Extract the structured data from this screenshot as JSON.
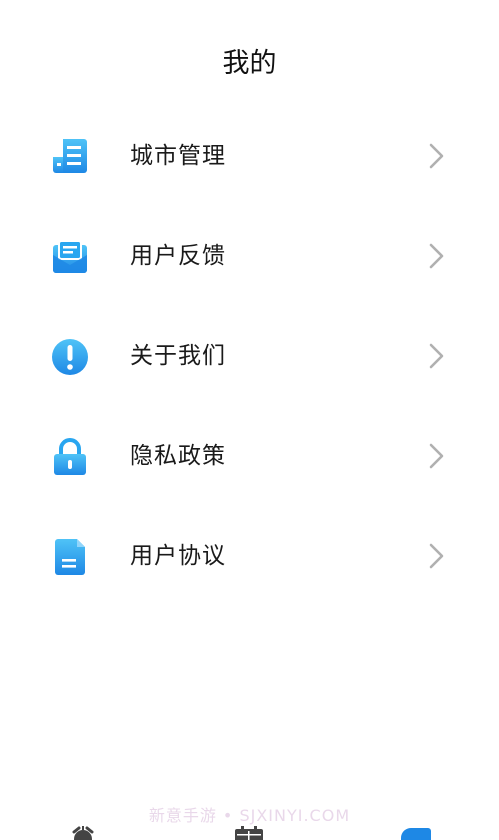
{
  "header": {
    "title": "我的"
  },
  "menu": {
    "items": [
      {
        "label": "城市管理",
        "icon": "city-list-icon"
      },
      {
        "label": "用户反馈",
        "icon": "mail-feedback-icon"
      },
      {
        "label": "关于我们",
        "icon": "info-exclamation-icon"
      },
      {
        "label": "隐私政策",
        "icon": "lock-icon"
      },
      {
        "label": "用户协议",
        "icon": "document-icon"
      }
    ],
    "chevron_icon": "chevron-right-icon"
  },
  "watermark": {
    "text": "新意手游 • SJXINYI.COM"
  },
  "tabbar": {
    "tabs": [
      {
        "icon": "alarm-clock-icon"
      },
      {
        "icon": "calendar-icon"
      },
      {
        "icon": "profile-icon",
        "active": true
      }
    ]
  },
  "colors": {
    "accent_light": "#4fc3f7",
    "accent_dark": "#1e88e5",
    "chevron": "#b0b0b0",
    "text": "#1a1a1a"
  }
}
